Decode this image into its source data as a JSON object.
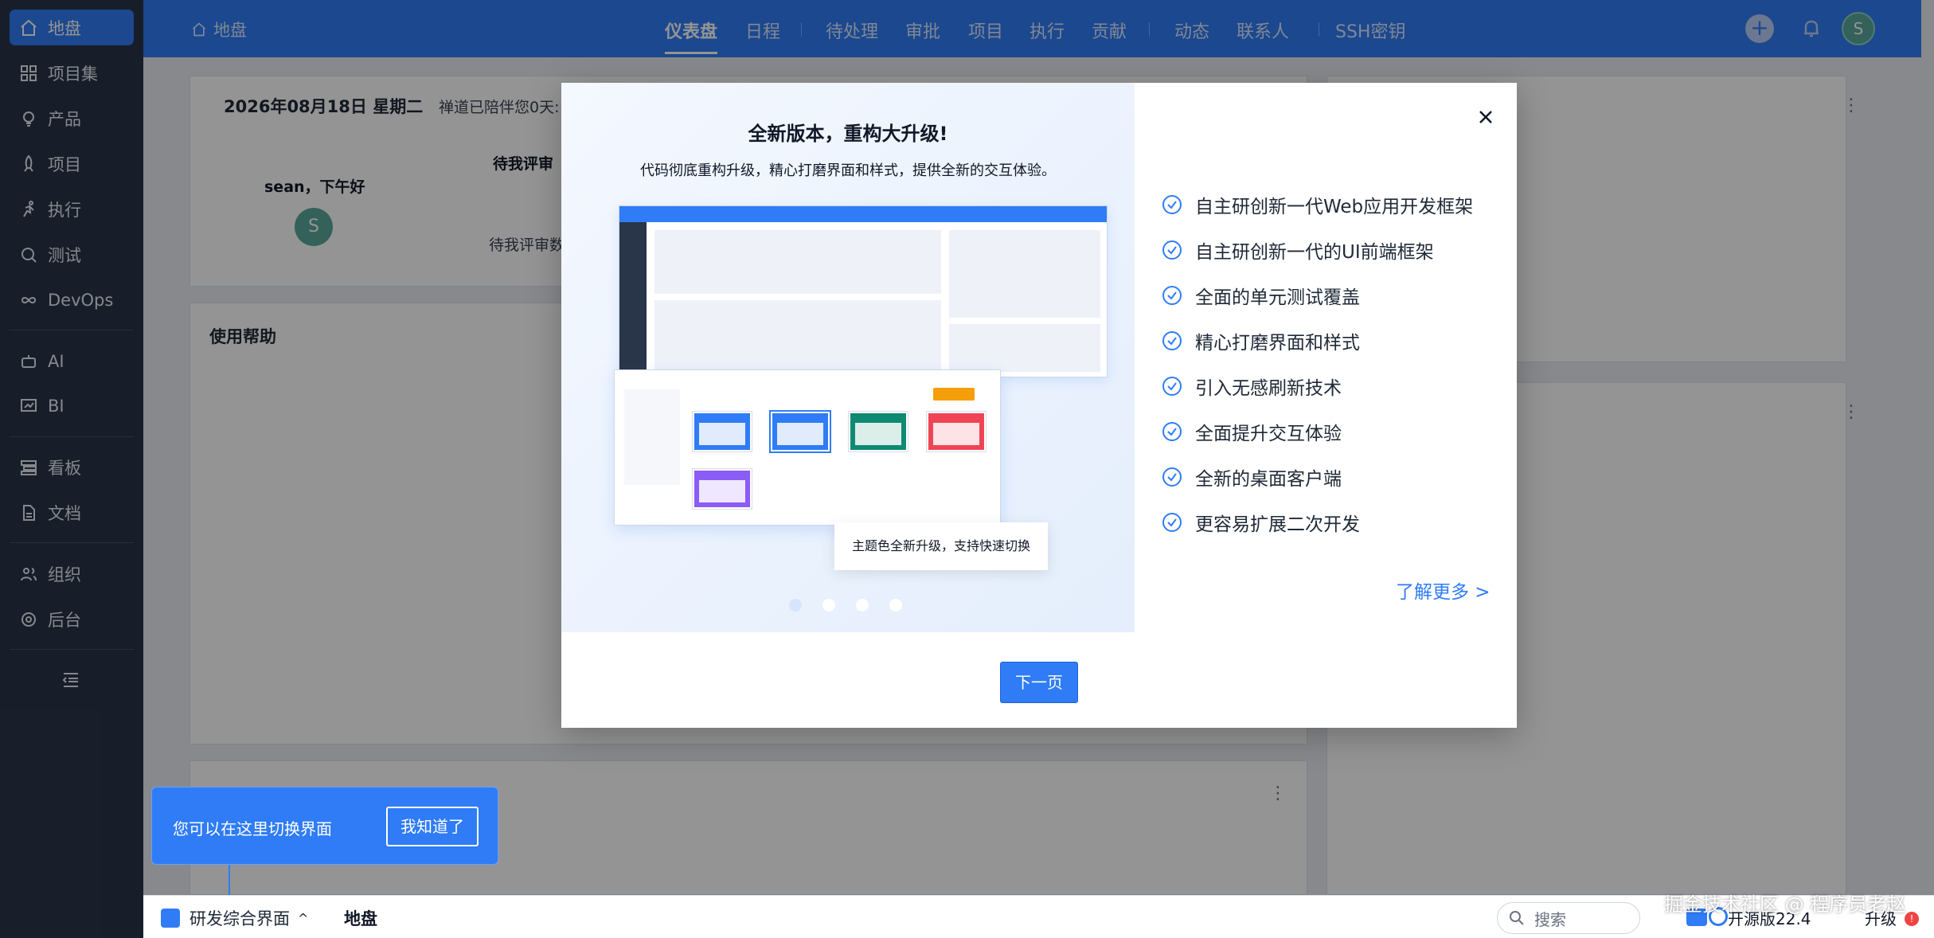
{
  "sidebar": {
    "items": [
      {
        "label": "地盘",
        "icon": "home-icon",
        "active": true
      },
      {
        "label": "项目集",
        "icon": "grid-icon"
      },
      {
        "label": "产品",
        "icon": "bulb-icon"
      },
      {
        "label": "项目",
        "icon": "rocket-icon"
      },
      {
        "label": "执行",
        "icon": "run-icon"
      },
      {
        "label": "测试",
        "icon": "search-bug-icon"
      },
      {
        "label": "DevOps",
        "icon": "infinity-icon"
      },
      {
        "label": "AI",
        "icon": "robot-icon"
      },
      {
        "label": "BI",
        "icon": "chart-icon"
      },
      {
        "label": "看板",
        "icon": "board-icon"
      },
      {
        "label": "文档",
        "icon": "document-icon"
      },
      {
        "label": "组织",
        "icon": "users-icon"
      },
      {
        "label": "后台",
        "icon": "gear-icon"
      }
    ]
  },
  "topbar": {
    "breadcrumb": "地盘",
    "nav": [
      "仪表盘",
      "日程",
      "待处理",
      "审批",
      "项目",
      "执行",
      "贡献",
      "动态",
      "联系人",
      "SSH密钥"
    ],
    "avatar": "S"
  },
  "dashboard": {
    "date": "2026年08月18日 星期二",
    "days_with": "禅道已陪伴您0天:",
    "greeting": "sean，下午好",
    "avatar": "S",
    "pending_review": "待我评审",
    "pending_review_count": "待我评审数",
    "help_title": "使用帮助",
    "more": "⋮"
  },
  "modal": {
    "title": "全新版本，重构大升级!",
    "subtitle": "代码彻底重构升级，精心打磨界面和样式，提供全新的交互体验。",
    "tooltip": "主题色全新升级，支持快速切换",
    "features": [
      "自主研创新一代Web应用开发框架",
      "自主研创新一代的UI前端框架",
      "全面的单元测试覆盖",
      "精心打磨界面和样式",
      "引入无感刷新技术",
      "全面提升交互体验",
      "全新的桌面客户端",
      "更容易扩展二次开发"
    ],
    "learn_more": "了解更多 >",
    "next_button": "下一页",
    "close": "×"
  },
  "tip": {
    "text": "您可以在这里切换界面",
    "button": "我知道了"
  },
  "bottombar": {
    "switch_label": "研发综合界面",
    "page": "地盘",
    "search_placeholder": "搜索",
    "version": "开源版22.4",
    "upgrade": "升级",
    "upgrade_badge": "!"
  },
  "watermark": "掘金技术社区 @ 程序员老赵",
  "colors": {
    "primary": "#2f7cf6",
    "sidebar": "#293549"
  }
}
